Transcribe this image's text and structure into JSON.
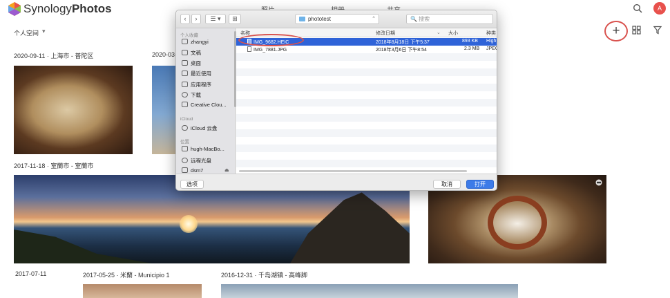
{
  "app": {
    "brand_light": "Synology",
    "brand_bold": "Photos",
    "tabs": [
      "照片",
      "相册",
      "共享"
    ],
    "avatar_letter": "A",
    "space_label": "个人空间",
    "space_dropdown": "▾",
    "add_glyph": "+"
  },
  "timeline": {
    "dates": [
      "2020-09-11 · 上海市 - 普陀区",
      "2020-03-",
      "2017-11-18 · 室蘭市 - 室蘭市",
      "2017-07-11",
      "2017-05-25 · 米蘭 - Municipio 1",
      "2016-12-31 · 千岛湖镇 - 高峰脚"
    ]
  },
  "dialog": {
    "back": "‹",
    "forward": "›",
    "view_mode": "☰ ▾",
    "new_folder": "⊞",
    "location": "phototest",
    "location_arrow": "⌃",
    "search_placeholder": "🔍 搜索",
    "sidebar": {
      "favorites_heading": "个人收藏",
      "favorites": [
        "zhangyi",
        "文稿",
        "桌面",
        "最近使用",
        "应用程序",
        "下载",
        "Creative Clou..."
      ],
      "icloud_heading": "iCloud",
      "icloud": [
        "iCloud 云盘"
      ],
      "locations_heading": "位置",
      "locations": [
        "hugh-MacBo...",
        "远程光盘",
        "dsm7"
      ],
      "eject": "⏏"
    },
    "columns": {
      "name": "名称",
      "modified": "修改日期",
      "size": "大小",
      "kind": "种类"
    },
    "files": [
      {
        "name": "IMG_9682.HEIC",
        "modified": "2018年8月18日 下午5:37",
        "size": "893 KB",
        "kind": "High"
      },
      {
        "name": "IMG_7881.JPG",
        "modified": "2018年3月6日 下午8:54",
        "size": "2.3 MB",
        "kind": "JPEG"
      }
    ],
    "options_button": "选项",
    "cancel_button": "取消",
    "open_button": "打开"
  },
  "colors": {
    "accent_red": "#d9534f",
    "selection_blue": "#2f63d8",
    "primary_button": "#3d7be8"
  }
}
